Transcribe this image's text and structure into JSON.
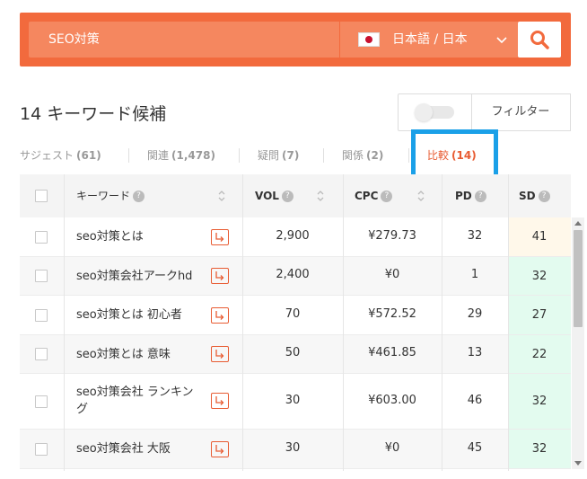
{
  "search": {
    "value": "SEO対策",
    "language": "日本語 / 日本"
  },
  "heading": "14 キーワード候補",
  "filter_label": "フィルター",
  "tabs": [
    {
      "label": "サジェスト",
      "count": "(61)"
    },
    {
      "label": "関連",
      "count": "(1,478)"
    },
    {
      "label": "疑問",
      "count": "(7)"
    },
    {
      "label": "関係",
      "count": "(2)"
    },
    {
      "label": "比較",
      "count": "(14)"
    }
  ],
  "active_tab": 4,
  "columns": {
    "keyword": "キーワード",
    "vol": "VOL",
    "cpc": "CPC",
    "pd": "PD",
    "sd": "SD",
    "help": "?"
  },
  "rows": [
    {
      "keyword": "seo対策とは",
      "vol": "2,900",
      "cpc": "¥279.73",
      "pd": "32",
      "sd": "41"
    },
    {
      "keyword": "seo対策会社アークhd",
      "vol": "2,400",
      "cpc": "¥0",
      "pd": "1",
      "sd": "32"
    },
    {
      "keyword": "seo対策とは 初心者",
      "vol": "70",
      "cpc": "¥572.52",
      "pd": "29",
      "sd": "27"
    },
    {
      "keyword": "seo対策とは 意味",
      "vol": "50",
      "cpc": "¥461.85",
      "pd": "13",
      "sd": "22"
    },
    {
      "keyword": "seo対策会社 ランキング",
      "vol": "30",
      "cpc": "¥603.00",
      "pd": "46",
      "sd": "32"
    },
    {
      "keyword": "seo対策会社 大阪",
      "vol": "30",
      "cpc": "¥0",
      "pd": "45",
      "sd": "32"
    }
  ],
  "colors": {
    "accent": "#f26a3d",
    "highlight": "#1aa0e8",
    "sd_medium": "#fff8ea",
    "sd_easy": "#e3fbef"
  }
}
